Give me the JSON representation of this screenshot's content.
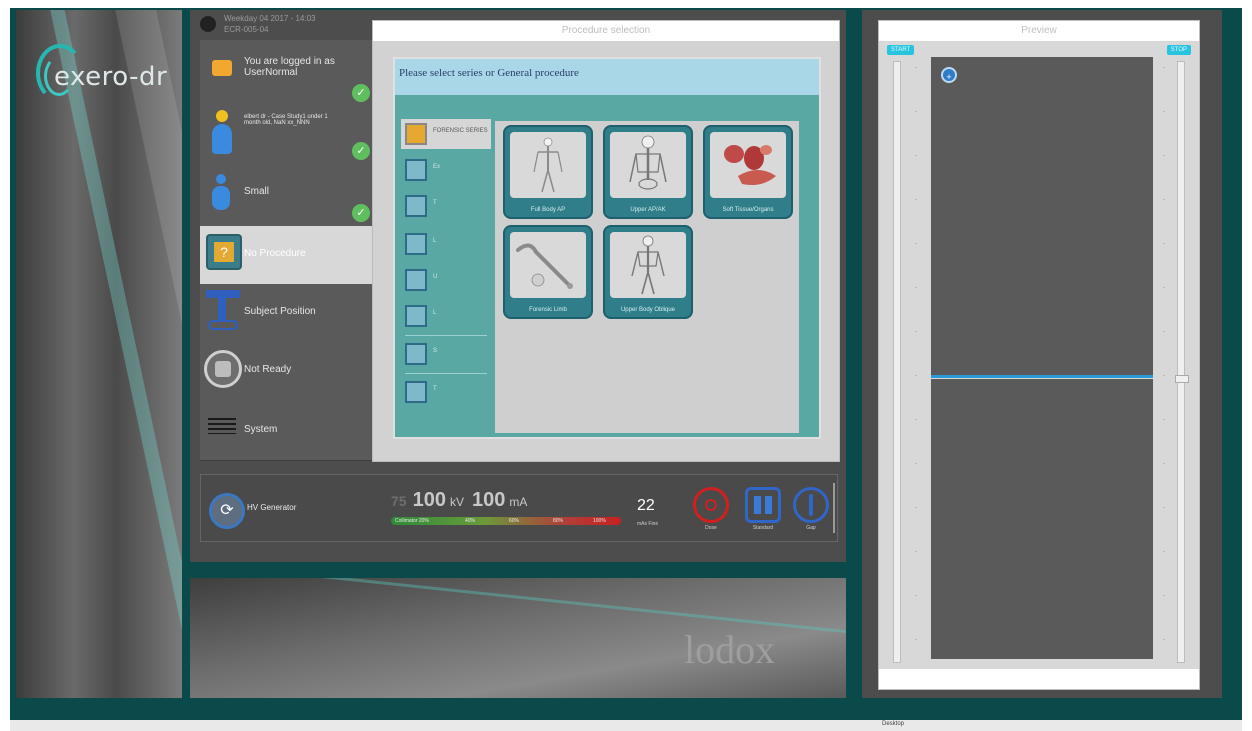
{
  "brand": {
    "logo": "exero-dr",
    "accent": "#27b6b0"
  },
  "user": {
    "header_line1": "Weekday 04 2017 - 14:03",
    "header_line2": "ECR-005-04"
  },
  "sidebar": {
    "items": [
      {
        "label": "You are logged in as UserNormal",
        "icon": "lock-icon",
        "done": true
      },
      {
        "label": "elbert dr - Case Study1 under 1 month old, NaN xx_NNN",
        "icon": "person-icon",
        "done": true
      },
      {
        "label": "Small",
        "icon": "person-small-icon",
        "done": true
      },
      {
        "label": "No Procedure",
        "icon": "question-icon",
        "done": false
      },
      {
        "label": "Subject Position",
        "icon": "table-position-icon",
        "done": false
      },
      {
        "label": "Not Ready",
        "icon": "status-ring-icon",
        "done": false
      },
      {
        "label": "System",
        "icon": "menu-lines-icon",
        "done": false
      }
    ]
  },
  "dialog": {
    "title": "Procedure selection",
    "prompt": "Please select series or General procedure",
    "categories": [
      {
        "label": "FORENSIC SERIES",
        "selected": true
      },
      {
        "label": "Ex",
        "selected": false
      },
      {
        "label": "T",
        "selected": false
      },
      {
        "label": "L",
        "selected": false
      },
      {
        "label": "U",
        "selected": false
      },
      {
        "label": "L",
        "selected": false
      },
      {
        "label": "S",
        "selected": false
      },
      {
        "label": "T",
        "selected": false
      }
    ],
    "cards": [
      {
        "caption": "Full Body AP",
        "icon": "skeleton-icon"
      },
      {
        "caption": "Upper AP/AK",
        "icon": "upper-skeleton-icon"
      },
      {
        "caption": "Soft Tissue/Organs",
        "icon": "organs-icon"
      },
      {
        "caption": "Forensic Limb",
        "icon": "limb-bone-icon"
      },
      {
        "caption": "Upper Body Oblique",
        "icon": "oblique-skeleton-icon"
      }
    ]
  },
  "generator": {
    "label": "HV Generator",
    "kv_dim": "75",
    "kv_value": "100",
    "kv_unit": "kV",
    "ma_value": "100",
    "ma_unit": "mA",
    "meter_labels": [
      "Collimator 20%",
      "40%",
      "60%",
      "80%",
      "100%"
    ],
    "mas_value": "22",
    "mas_label": "mAs Fine",
    "controls": [
      {
        "label": "Dose",
        "icon": "target-icon"
      },
      {
        "label": "Standard",
        "icon": "grid-icon"
      },
      {
        "label": "Gap",
        "icon": "gap-icon"
      }
    ]
  },
  "lodox": {
    "logo": "lodox"
  },
  "preview": {
    "title": "Preview",
    "start_tag": "START",
    "stop_tag": "STOP"
  },
  "status": {
    "text": "Desktop"
  }
}
